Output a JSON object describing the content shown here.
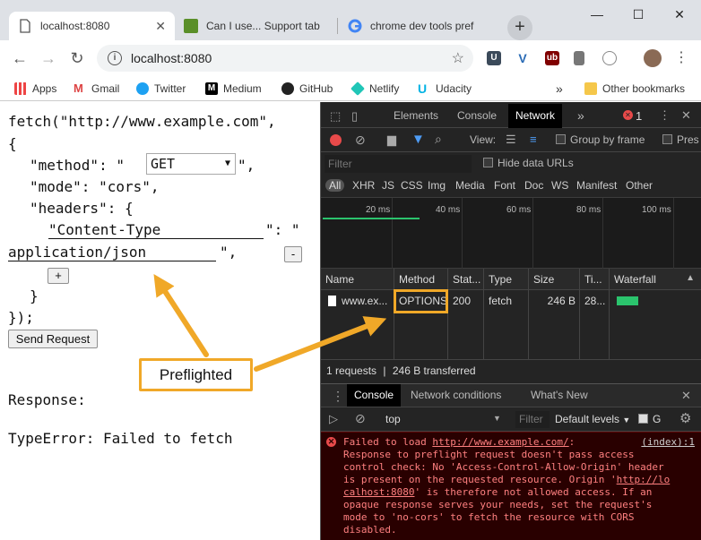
{
  "browser": {
    "tabs": [
      {
        "title": "localhost:8080",
        "active": true
      },
      {
        "title": "Can I use... Support tab",
        "active": false
      },
      {
        "title": "chrome dev tools pref",
        "active": false
      }
    ],
    "new_tab": "+",
    "window_controls": {
      "minimize": "—",
      "maximize": "☐",
      "close": "✕"
    },
    "url": "localhost:8080",
    "bookmarks": [
      "Apps",
      "Gmail",
      "Twitter",
      "Medium",
      "GitHub",
      "Netlify",
      "Udacity"
    ],
    "bookmarks_overflow": "»",
    "other_bookmarks": "Other bookmarks"
  },
  "page": {
    "line_fetch": "fetch(\"http://www.example.com\",",
    "line_open": "{",
    "method_prefix": "\"method\": \"",
    "method_value": "GET",
    "method_suffix": "\",",
    "mode_line": "\"mode\": \"cors\",",
    "headers_line": "\"headers\": {",
    "header_key": "\"Content-Type",
    "header_mid": "\": \"",
    "header_value": "application/json",
    "header_end": "\",",
    "remove_label": "-",
    "add_label": "+",
    "close_brace": "}",
    "close_paren": "});",
    "send_label": "Send Request",
    "response_label": "Response:",
    "response_text": "TypeError: Failed to fetch"
  },
  "devtools": {
    "tabs": [
      "Elements",
      "Console",
      "Network"
    ],
    "active_tab": "Network",
    "more": "»",
    "error_count": "1",
    "view_label": "View:",
    "group_by_frame": "Group by frame",
    "preserve": "Pres",
    "filter_placeholder": "Filter",
    "hide_data_urls": "Hide data URLs",
    "type_filters": [
      "All",
      "XHR",
      "JS",
      "CSS",
      "Img",
      "Media",
      "Font",
      "Doc",
      "WS",
      "Manifest",
      "Other"
    ],
    "timeline_ticks": [
      "20 ms",
      "40 ms",
      "60 ms",
      "80 ms",
      "100 ms"
    ],
    "columns": [
      "Name",
      "Method",
      "Stat...",
      "Type",
      "Size",
      "Ti...",
      "Waterfall"
    ],
    "row": {
      "name": "www.ex...",
      "method": "OPTIONS",
      "status": "200",
      "type": "fetch",
      "size": "246 B",
      "time": "28..."
    },
    "summary_requests": "1 requests",
    "summary_sep": "|",
    "summary_transferred": "246 B transferred",
    "drawer_tabs": [
      "Console",
      "Network conditions",
      "What's New"
    ],
    "context": "top",
    "console_filter": "Filter",
    "levels": "Default levels",
    "group_label": "G",
    "error": {
      "prefix": "Failed to load ",
      "url": "http://www.example.com/",
      "colon": ":",
      "source": "(index):1",
      "line2": "Response to preflight request doesn't pass access",
      "line3": "control check: No 'Access-Control-Allow-Origin' header",
      "line4_pre": "is present on the requested resource. Origin '",
      "line4_link": "http://lo",
      "line5_link": "calhost:8080",
      "line5_post": "' is therefore not allowed access. If an",
      "line6": "opaque response serves your needs, set the request's",
      "line7": "mode to 'no-cors' to fetch the resource with CORS",
      "line8": "disabled."
    }
  },
  "annotation": {
    "callout": "Preflighted",
    "color": "#f0a828"
  }
}
